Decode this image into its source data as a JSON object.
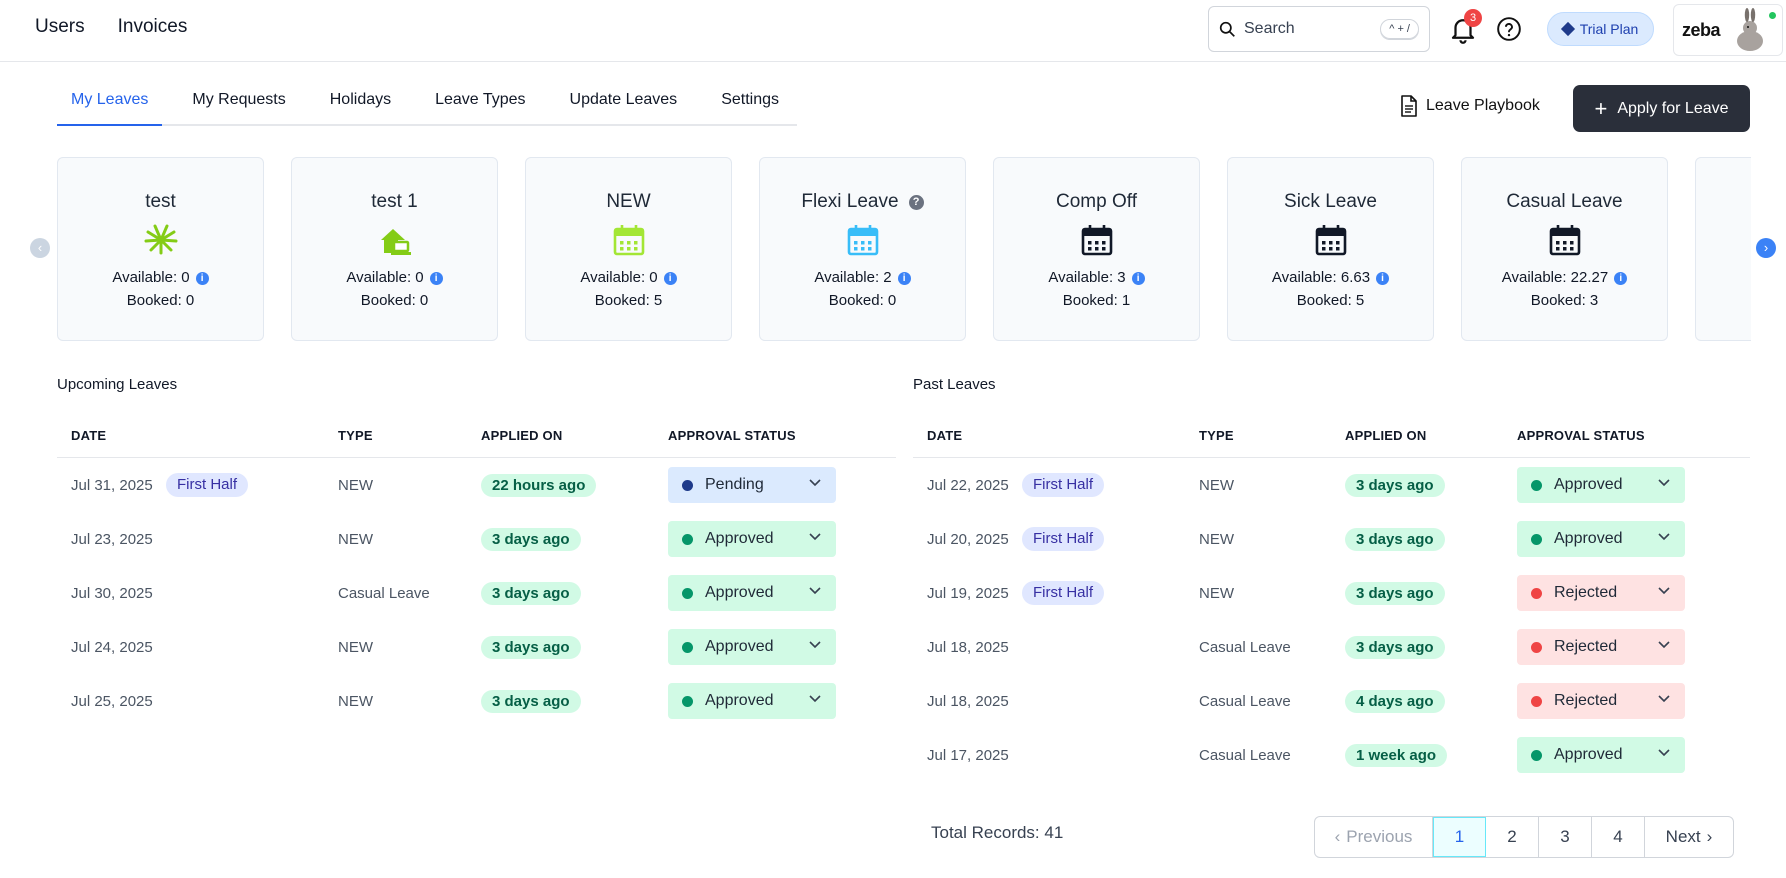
{
  "topbar": {
    "nav": [
      "Users",
      "Invoices"
    ],
    "search_placeholder": "Search",
    "search_shortcut": "^ + /",
    "notification_count": "3",
    "trial_label": "Trial Plan",
    "profile_logo": "zeba"
  },
  "tabs": [
    "My Leaves",
    "My Requests",
    "Holidays",
    "Leave Types",
    "Update Leaves",
    "Settings"
  ],
  "active_tab": "My Leaves",
  "actions": {
    "playbook_label": "Leave Playbook",
    "apply_label": "Apply for Leave"
  },
  "cards": [
    {
      "title": "test",
      "icon": "palm-icon",
      "color": "#84cc16",
      "available": "Available: 0",
      "booked": "Booked: 0"
    },
    {
      "title": "test 1",
      "icon": "home-laptop-icon",
      "color": "#84cc16",
      "available": "Available: 0",
      "booked": "Booked: 0"
    },
    {
      "title": "NEW",
      "icon": "calendar-icon",
      "color": "#a3e635",
      "available": "Available: 0",
      "booked": "Booked: 5"
    },
    {
      "title": "Flexi Leave",
      "icon": "calendar-icon",
      "color": "#38bdf8",
      "available": "Available: 2",
      "booked": "Booked: 0",
      "help": true
    },
    {
      "title": "Comp Off",
      "icon": "calendar-icon",
      "color": "#111827",
      "available": "Available: 3",
      "booked": "Booked: 1"
    },
    {
      "title": "Sick Leave",
      "icon": "calendar-icon",
      "color": "#111827",
      "available": "Available: 6.63",
      "booked": "Booked: 5"
    },
    {
      "title": "Casual Leave",
      "icon": "calendar-icon",
      "color": "#111827",
      "available": "Available: 22.27",
      "booked": "Booked: 3"
    }
  ],
  "upcoming": {
    "title": "Upcoming Leaves",
    "headers": [
      "DATE",
      "TYPE",
      "APPLIED ON",
      "APPROVAL STATUS"
    ],
    "rows": [
      {
        "date": "Jul 31, 2025",
        "half": "First Half",
        "type": "NEW",
        "applied": "22 hours ago",
        "status": "Pending"
      },
      {
        "date": "Jul 23, 2025",
        "half": "",
        "type": "NEW",
        "applied": "3 days ago",
        "status": "Approved"
      },
      {
        "date": "Jul 30, 2025",
        "half": "",
        "type": "Casual Leave",
        "applied": "3 days ago",
        "status": "Approved"
      },
      {
        "date": "Jul 24, 2025",
        "half": "",
        "type": "NEW",
        "applied": "3 days ago",
        "status": "Approved"
      },
      {
        "date": "Jul 25, 2025",
        "half": "",
        "type": "NEW",
        "applied": "3 days ago",
        "status": "Approved"
      }
    ]
  },
  "past": {
    "title": "Past Leaves",
    "headers": [
      "DATE",
      "TYPE",
      "APPLIED ON",
      "APPROVAL STATUS"
    ],
    "rows": [
      {
        "date": "Jul 22, 2025",
        "half": "First Half",
        "type": "NEW",
        "applied": "3 days ago",
        "status": "Approved"
      },
      {
        "date": "Jul 20, 2025",
        "half": "First Half",
        "type": "NEW",
        "applied": "3 days ago",
        "status": "Approved"
      },
      {
        "date": "Jul 19, 2025",
        "half": "First Half",
        "type": "NEW",
        "applied": "3 days ago",
        "status": "Rejected"
      },
      {
        "date": "Jul 18, 2025",
        "half": "",
        "type": "Casual Leave",
        "applied": "3 days ago",
        "status": "Rejected"
      },
      {
        "date": "Jul 18, 2025",
        "half": "",
        "type": "Casual Leave",
        "applied": "4 days ago",
        "status": "Rejected"
      },
      {
        "date": "Jul 17, 2025",
        "half": "",
        "type": "Casual Leave",
        "applied": "1 week ago",
        "status": "Approved"
      }
    ],
    "total_records": "Total Records: 41"
  },
  "pagination": {
    "previous": "Previous",
    "pages": [
      "1",
      "2",
      "3",
      "4"
    ],
    "current": "1",
    "next": "Next"
  },
  "status_colors": {
    "Pending": "#1e3a8a",
    "Approved": "#059669",
    "Rejected": "#ef4444"
  }
}
